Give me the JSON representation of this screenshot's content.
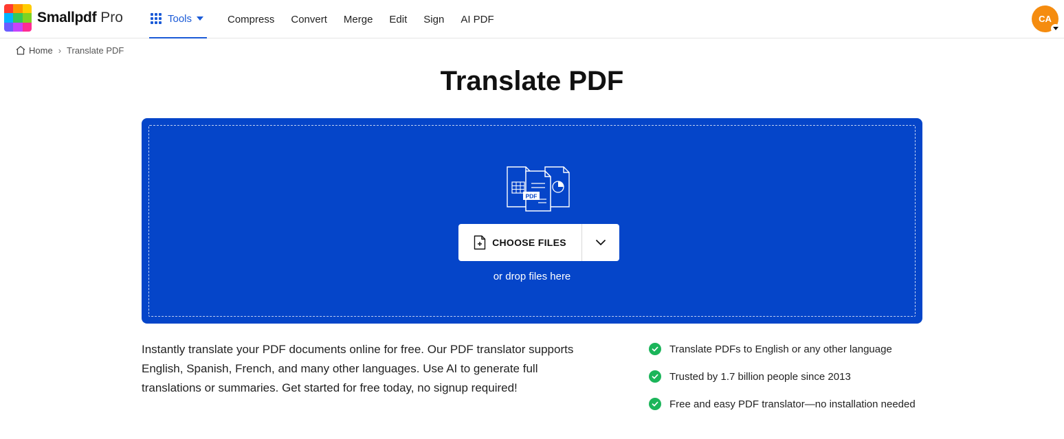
{
  "brand": {
    "name": "Smallpdf",
    "tier": "Pro",
    "logo_colors": [
      "#ff3b30",
      "#ff9500",
      "#ffcc00",
      "#00b4ff",
      "#34c759",
      "#7ed321",
      "#6a5cff",
      "#c643fc",
      "#ff2d92"
    ]
  },
  "nav": {
    "tools_label": "Tools",
    "items": [
      "Compress",
      "Convert",
      "Merge",
      "Edit",
      "Sign",
      "AI PDF"
    ]
  },
  "user": {
    "initials": "CA",
    "avatar_color": "#f58c0f"
  },
  "breadcrumb": {
    "home": "Home",
    "separator": "›",
    "current": "Translate PDF"
  },
  "page": {
    "title": "Translate PDF"
  },
  "upload": {
    "choose_label": "CHOOSE FILES",
    "drop_hint": "or drop files here",
    "panel_color": "#0545c9"
  },
  "description": "Instantly translate your PDF documents online for free. Our PDF translator supports English, Spanish, French, and many other languages. Use AI to generate full translations or summaries. Get started for free today, no signup required!",
  "features": [
    "Translate PDFs to English or any other language",
    "Trusted by 1.7 billion people since 2013",
    "Free and easy PDF translator—no installation needed"
  ],
  "colors": {
    "accent": "#1a5ad7",
    "check": "#1bb55a"
  }
}
